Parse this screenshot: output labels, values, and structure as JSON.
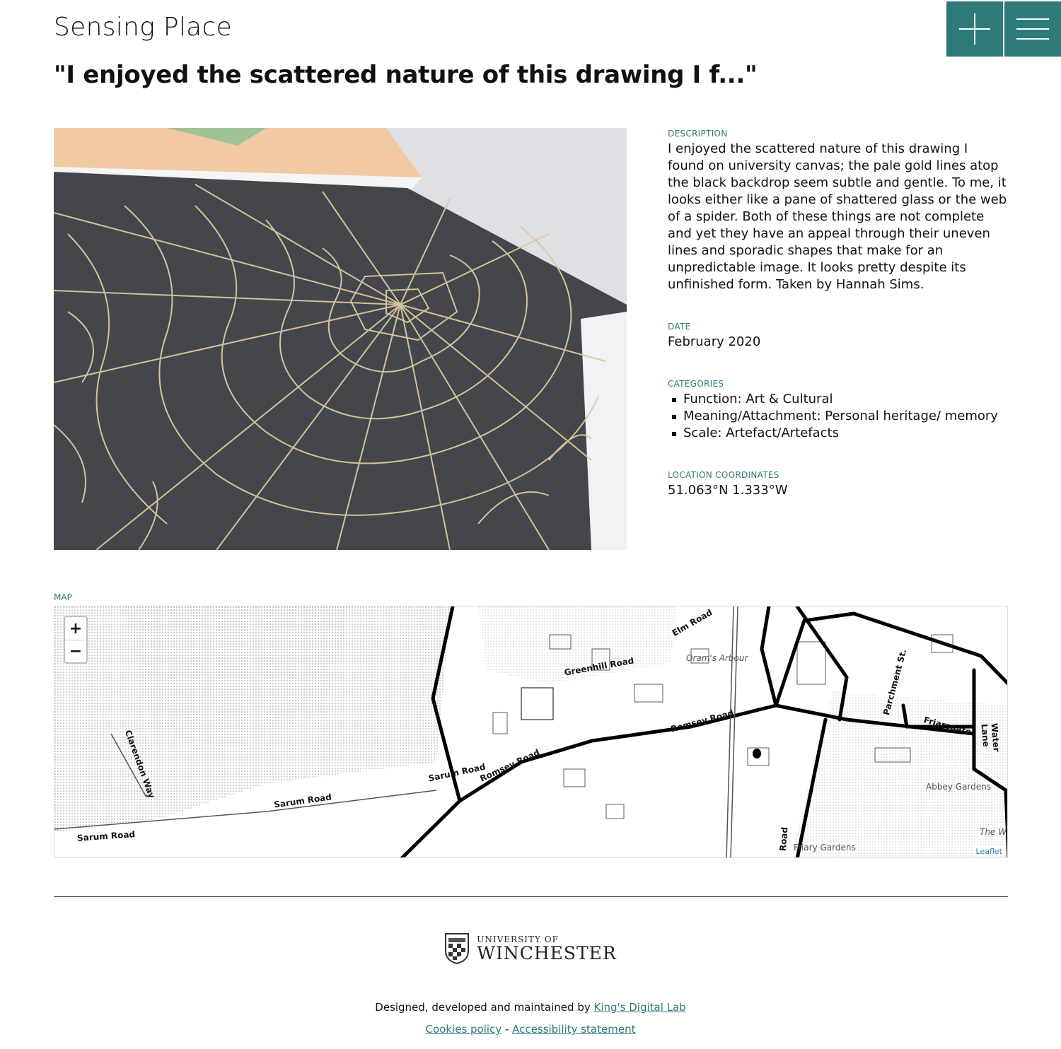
{
  "header": {
    "site_title": "Sensing Place",
    "add_icon": "plus-icon",
    "menu_icon": "hamburger-menu-icon"
  },
  "page": {
    "title": "\"I enjoyed the scattered nature of this drawing I f...\""
  },
  "meta": {
    "description_label": "DESCRIPTION",
    "description": "I enjoyed the scattered nature of this drawing I found on university canvas; the pale gold lines atop the black backdrop seem subtle and gentle. To me, it looks either like a pane of shattered glass or the web of a spider. Both of these things are not complete and yet they have an appeal through their uneven lines and sporadic shapes that make for an unpredictable image. It looks pretty despite its unfinished form. Taken by Hannah Sims.",
    "date_label": "DATE",
    "date": "February 2020",
    "categories_label": "CATEGORIES",
    "categories": [
      "Function: Art & Cultural",
      "Meaning/Attachment: Personal heritage/ memory",
      "Scale: Artefact/Artefacts"
    ],
    "location_label": "LOCATION COORDINATES",
    "location": "51.063°N 1.333°W"
  },
  "map": {
    "label": "MAP",
    "zoom_in": "+",
    "zoom_out": "−",
    "attribution": "Leaflet",
    "street_labels": [
      "Sarum Road",
      "Sarum Road",
      "Sarum Road",
      "Romsey Road",
      "Romsey Road",
      "Greenhill Road",
      "Elm Road",
      "Oram's Arbour",
      "Clarendon Way",
      "Parchment St.",
      "Friarsgate",
      "Water Lane",
      "Abbey Gardens",
      "Friary Gardens",
      "Road",
      "The W"
    ]
  },
  "footer": {
    "logo_small": "UNIVERSITY OF",
    "logo_big": "WINCHESTER",
    "credits_prefix": "Designed, developed and maintained by ",
    "credits_link": "King's Digital Lab",
    "cookies_link": "Cookies policy",
    "separator": " - ",
    "accessibility_link": "Accessibility statement"
  }
}
